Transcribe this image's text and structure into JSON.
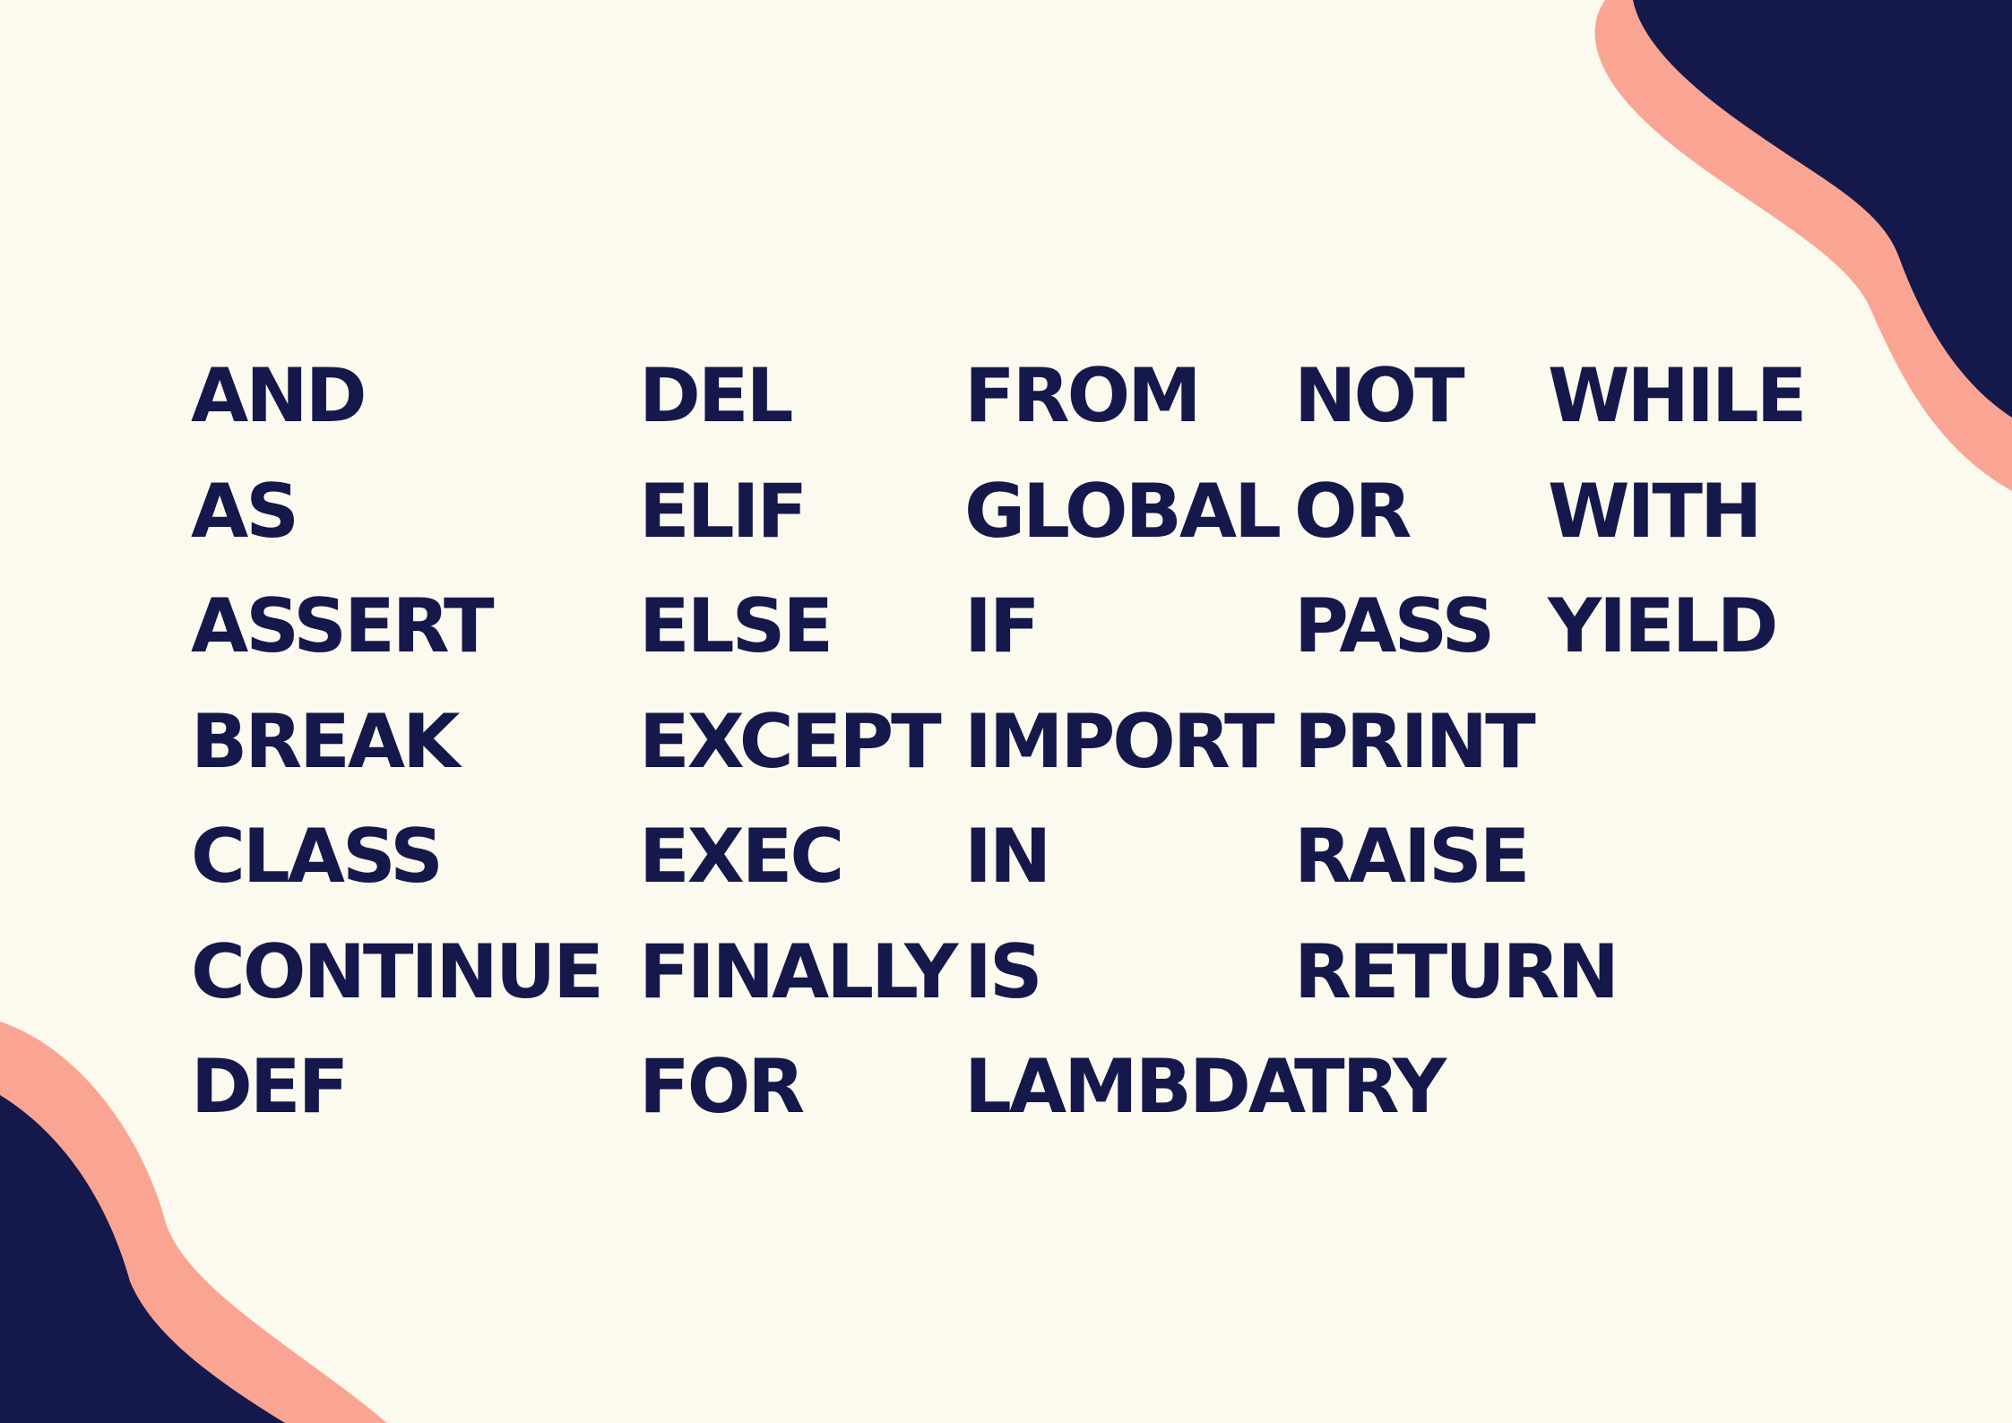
{
  "colors": {
    "background": "#FCF9EE",
    "text": "#15184B",
    "navy_blob": "#15184B",
    "salmon_blob": "#FAA593"
  },
  "keywords": {
    "col1": [
      "AND",
      "AS",
      "ASSERT",
      "BREAK",
      "CLASS",
      "CONTINUE",
      "DEF"
    ],
    "col2": [
      "DEL",
      "ELIF",
      "ELSE",
      "EXCEPT",
      "EXEC",
      "FINALLY",
      "FOR"
    ],
    "col3": [
      "FROM",
      "GLOBAL",
      "IF",
      "IMPORT",
      "IN",
      "IS",
      "LAMBDA"
    ],
    "col4": [
      "NOT",
      "OR",
      "PASS",
      "PRINT",
      "RAISE",
      "RETURN",
      "TRY"
    ],
    "col5": [
      "WHILE",
      "WITH",
      "YIELD"
    ]
  }
}
